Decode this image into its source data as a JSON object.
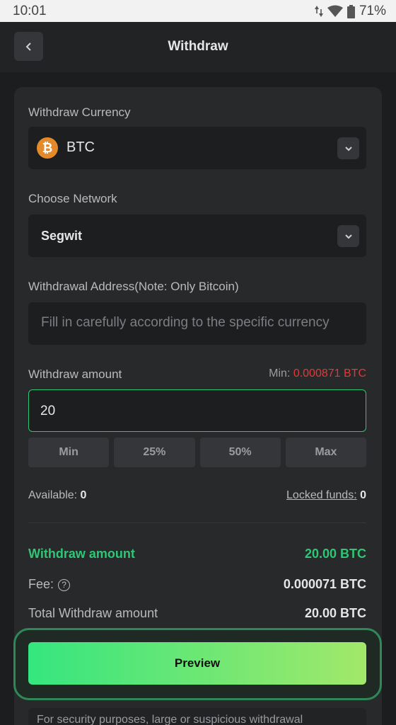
{
  "statusbar": {
    "time": "10:01",
    "battery": "71%"
  },
  "header": {
    "title": "Withdraw"
  },
  "currency": {
    "label": "Withdraw Currency",
    "value": "BTC",
    "coin_symbol": "₿"
  },
  "network": {
    "label": "Choose Network",
    "value": "Segwit"
  },
  "address": {
    "label": "Withdrawal Address(Note: Only Bitcoin)",
    "placeholder": "Fill in carefully according to the specific currency"
  },
  "amount": {
    "label": "Withdraw amount",
    "min_label": "Min:",
    "min_value": "0.000871 BTC",
    "value": "20"
  },
  "quick": [
    "Min",
    "25%",
    "50%",
    "Max"
  ],
  "balance": {
    "available_label": "Available:",
    "available_value": "0",
    "locked_label": "Locked funds:",
    "locked_value": "0"
  },
  "summary": {
    "withdraw_label": "Withdraw amount",
    "withdraw_value": "20.00 BTC",
    "fee_label": "Fee:",
    "fee_value": "0.000071 BTC",
    "total_label": "Total Withdraw amount",
    "total_value": "20.00 BTC"
  },
  "preview_label": "Preview",
  "notice": "For security purposes, large or suspicious withdrawal",
  "colors": {
    "accent": "#2fc675",
    "danger": "#e03a3a",
    "btc": "#e58a2b"
  }
}
